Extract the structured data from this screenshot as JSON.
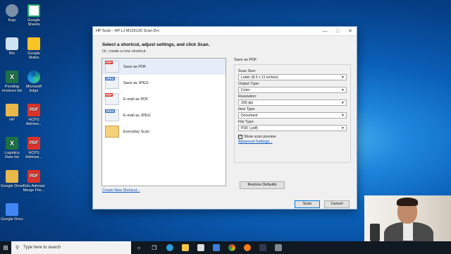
{
  "desktop": {
    "icons": [
      {
        "name": "desktop-icon-kujo",
        "label": "Kujo",
        "kind": "user"
      },
      {
        "name": "desktop-icon-google-sheets",
        "label": "Google Sheets",
        "kind": "gs"
      },
      {
        "name": "desktop-icon-recycle-bin",
        "label": "Bin",
        "kind": "bin"
      },
      {
        "name": "desktop-icon-google-slides",
        "label": "Google Slides",
        "kind": "gsl"
      },
      {
        "name": "desktop-icon-pending-invoices",
        "label": "Pending invoices list",
        "kind": "xls"
      },
      {
        "name": "desktop-icon-microsoft-edge",
        "label": "Microsoft Edge",
        "kind": "edge"
      },
      {
        "name": "desktop-icon-hp",
        "label": "HP",
        "kind": "folder"
      },
      {
        "name": "desktop-icon-pdf-1",
        "label": "HCPS Admiss...",
        "kind": "pdf"
      },
      {
        "name": "desktop-icon-logistics",
        "label": "Logistics Rate list",
        "kind": "xls"
      },
      {
        "name": "desktop-icon-pdf-2",
        "label": "HCPS Admissi...",
        "kind": "pdf"
      },
      {
        "name": "desktop-icon-google-drive",
        "label": "Google Drive",
        "kind": "folder"
      },
      {
        "name": "desktop-icon-pdf-3",
        "label": "Kids Admissi Merge File...",
        "kind": "pdf"
      },
      {
        "name": "desktop-icon-google-docs",
        "label": "Google Docs",
        "kind": "gdoc"
      }
    ]
  },
  "dialog": {
    "title": "HP Scan - HP LJ M125126 Scan Drv",
    "heading": "Select a shortcut, adjust settings, and click Scan.",
    "subheading": "Or, create a new shortcut.",
    "shortcuts": [
      {
        "label": "Save as PDF",
        "tag": "PDF",
        "tagkind": "p",
        "selected": true
      },
      {
        "label": "Save as JPEG",
        "tag": "JPEG",
        "tagkind": "j",
        "selected": false
      },
      {
        "label": "E-mail as PDF",
        "tag": "PDF",
        "tagkind": "p",
        "selected": false
      },
      {
        "label": "E-mail as JPEG",
        "tag": "JPEG",
        "tagkind": "j",
        "selected": false
      },
      {
        "label": "Everyday Scan",
        "tag": "",
        "tagkind": "fold",
        "selected": false
      }
    ],
    "create_link": "Create New Shortcut...",
    "settings": {
      "group_title": "Save as PDF",
      "scan_size_label": "Scan Size:",
      "scan_size_value": "Letter (8.5 x 11 inches)",
      "output_type_label": "Output Type:",
      "output_type_value": "Color",
      "resolution_label": "Resolution:",
      "resolution_value": "200 dpi",
      "item_type_label": "Item Type:",
      "item_type_value": "Document",
      "file_type_label": "File Type:",
      "file_type_value": "PDF (.pdf)",
      "show_preview_label": "Show scan preview",
      "show_preview_checked": true,
      "advanced_link": "Advanced Settings..."
    },
    "restore_button": "Restore Defaults",
    "scan_button": "Scan",
    "cancel_button": "Cancel"
  },
  "taskbar": {
    "search_placeholder": "Type here to search"
  }
}
